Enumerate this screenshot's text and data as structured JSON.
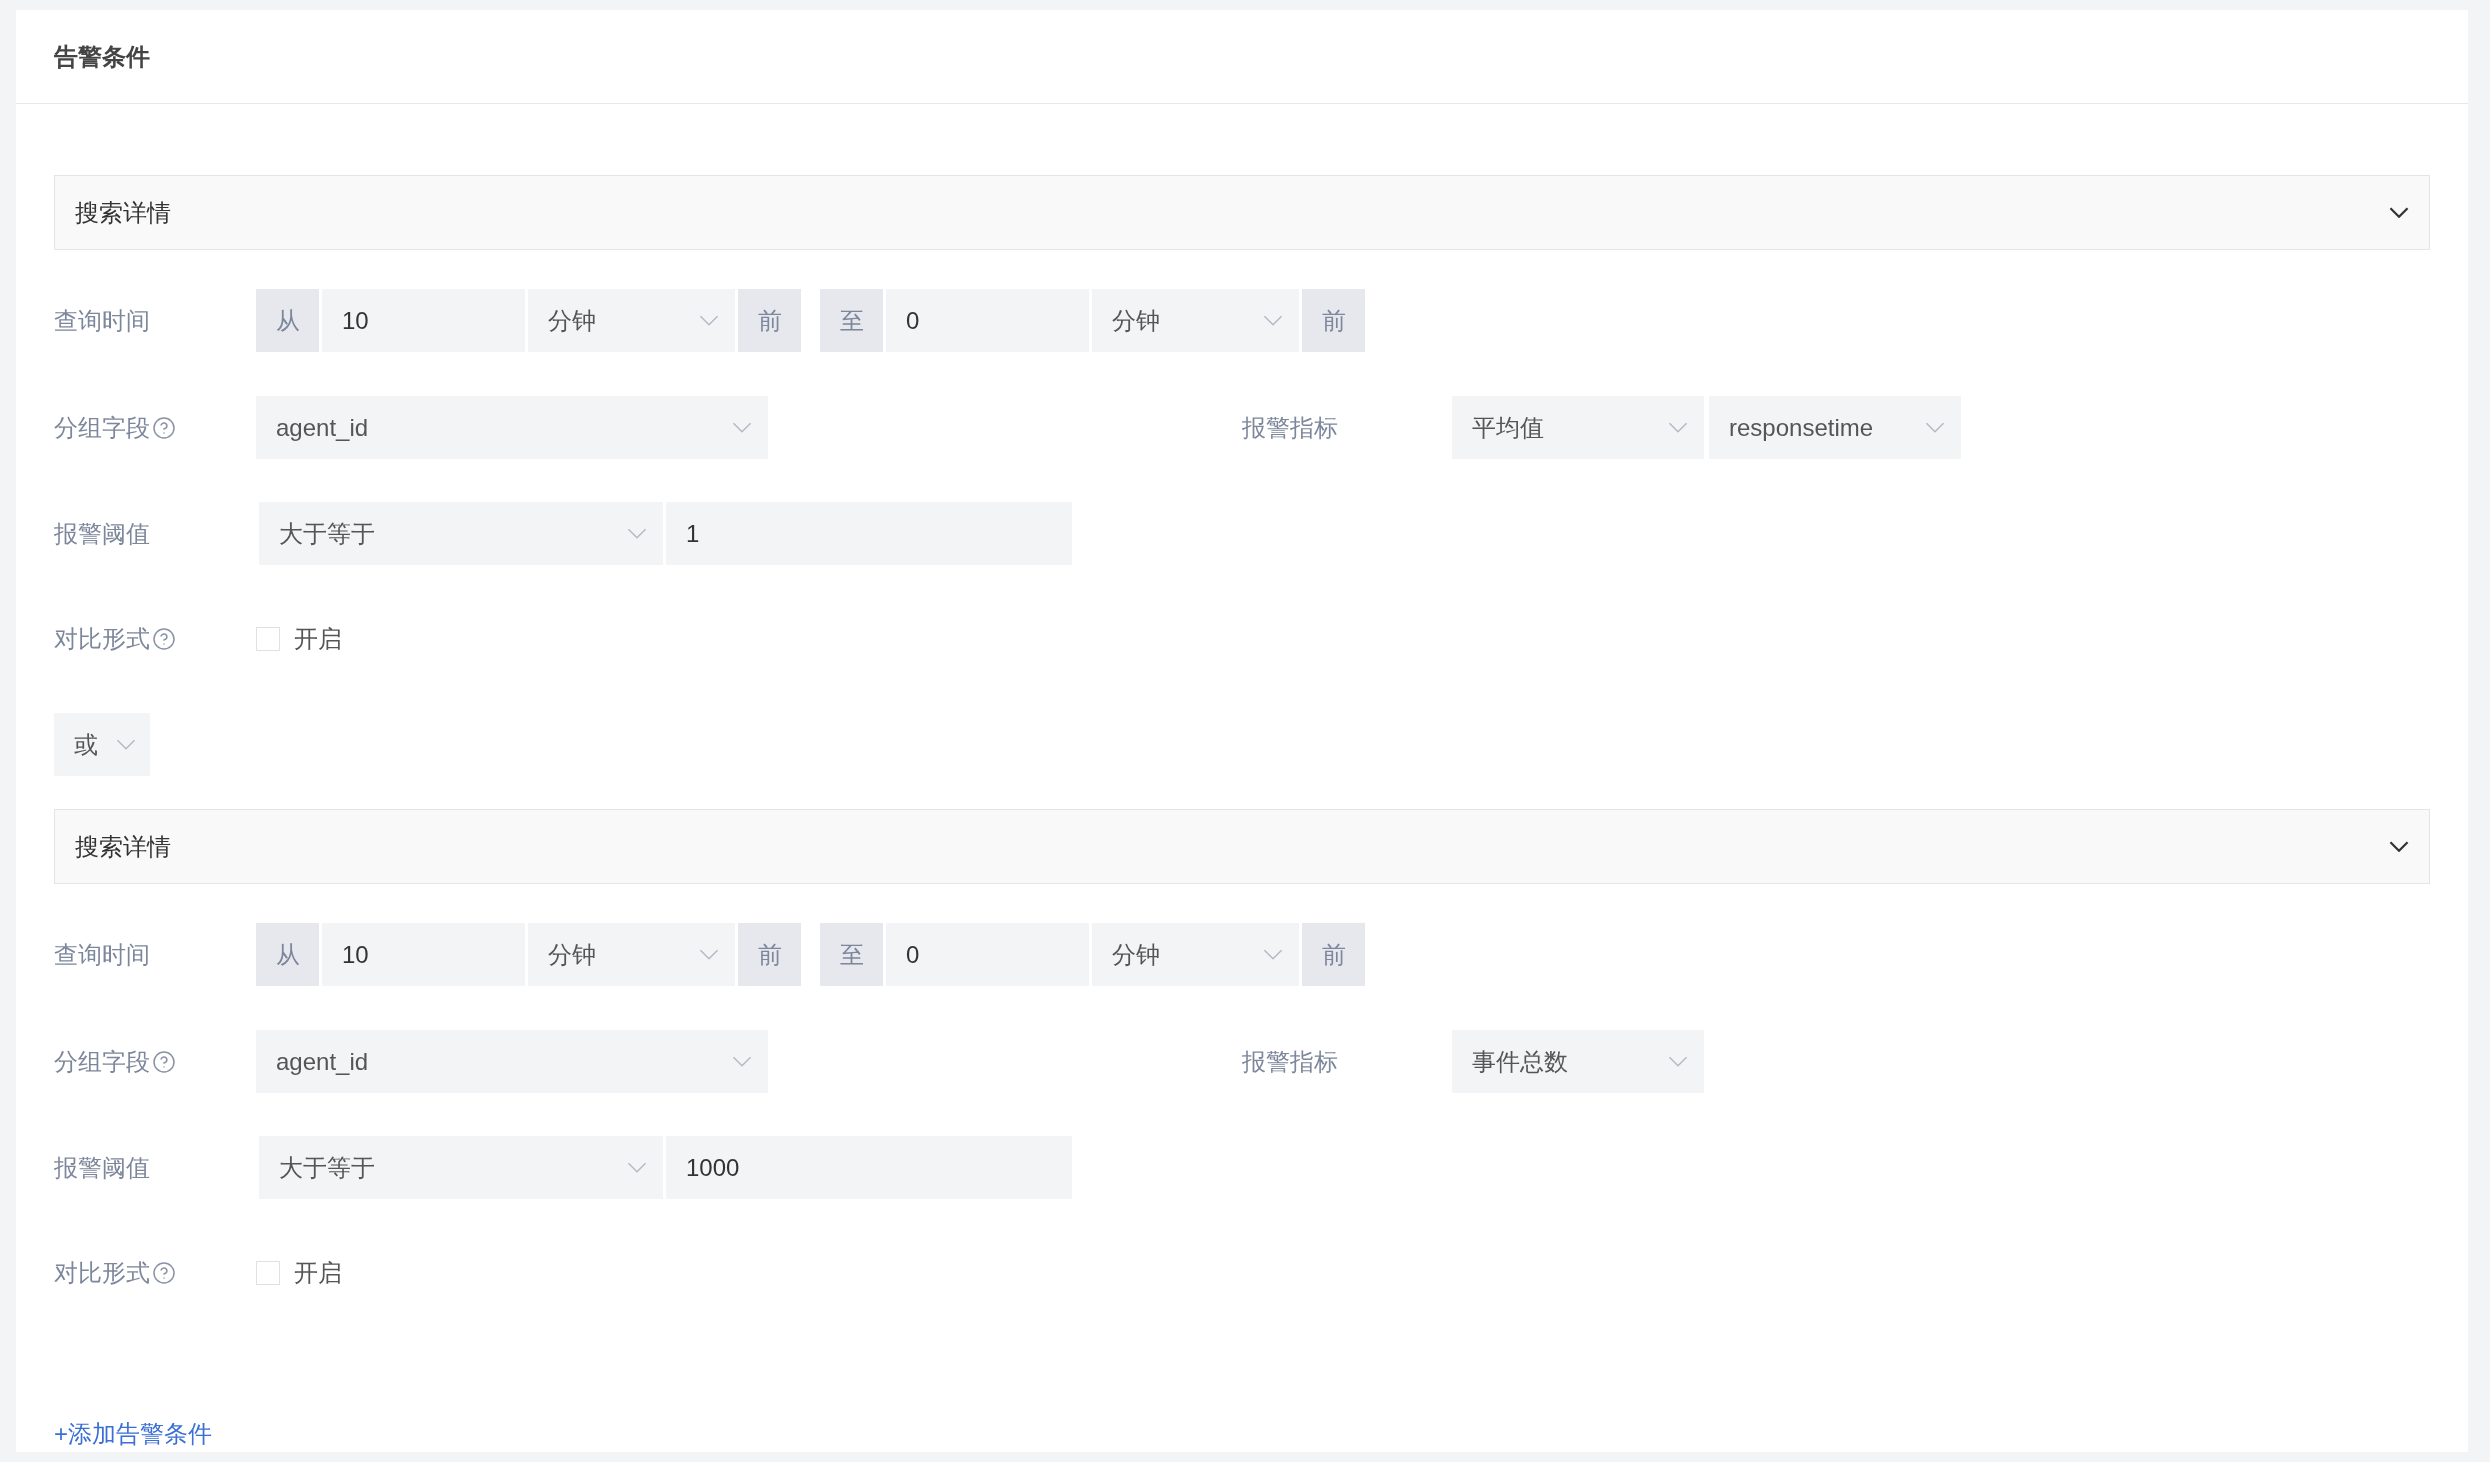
{
  "title": "告警条件",
  "conditions": [
    {
      "panel_title": "搜索详情",
      "time": {
        "label": "查询时间",
        "from": {
          "prefix": "从",
          "value": "10",
          "unit": "分钟",
          "suffix": "前"
        },
        "to": {
          "prefix": "至",
          "value": "0",
          "unit": "分钟",
          "suffix": "前"
        }
      },
      "group": {
        "label": "分组字段",
        "value": "agent_id"
      },
      "metric": {
        "label": "报警指标",
        "selects": [
          "平均值",
          "responsetime"
        ]
      },
      "threshold": {
        "label": "报警阈值",
        "operator": "大于等于",
        "value": "1"
      },
      "compare": {
        "label": "对比形式",
        "option": "开启",
        "checked": false
      }
    },
    {
      "panel_title": "搜索详情",
      "time": {
        "label": "查询时间",
        "from": {
          "prefix": "从",
          "value": "10",
          "unit": "分钟",
          "suffix": "前"
        },
        "to": {
          "prefix": "至",
          "value": "0",
          "unit": "分钟",
          "suffix": "前"
        }
      },
      "group": {
        "label": "分组字段",
        "value": "agent_id"
      },
      "metric": {
        "label": "报警指标",
        "selects": [
          "事件总数"
        ]
      },
      "threshold": {
        "label": "报警阈值",
        "operator": "大于等于",
        "value": "1000"
      },
      "compare": {
        "label": "对比形式",
        "option": "开启",
        "checked": false
      }
    }
  ],
  "logic_select": "或",
  "add_link": "+添加告警条件"
}
